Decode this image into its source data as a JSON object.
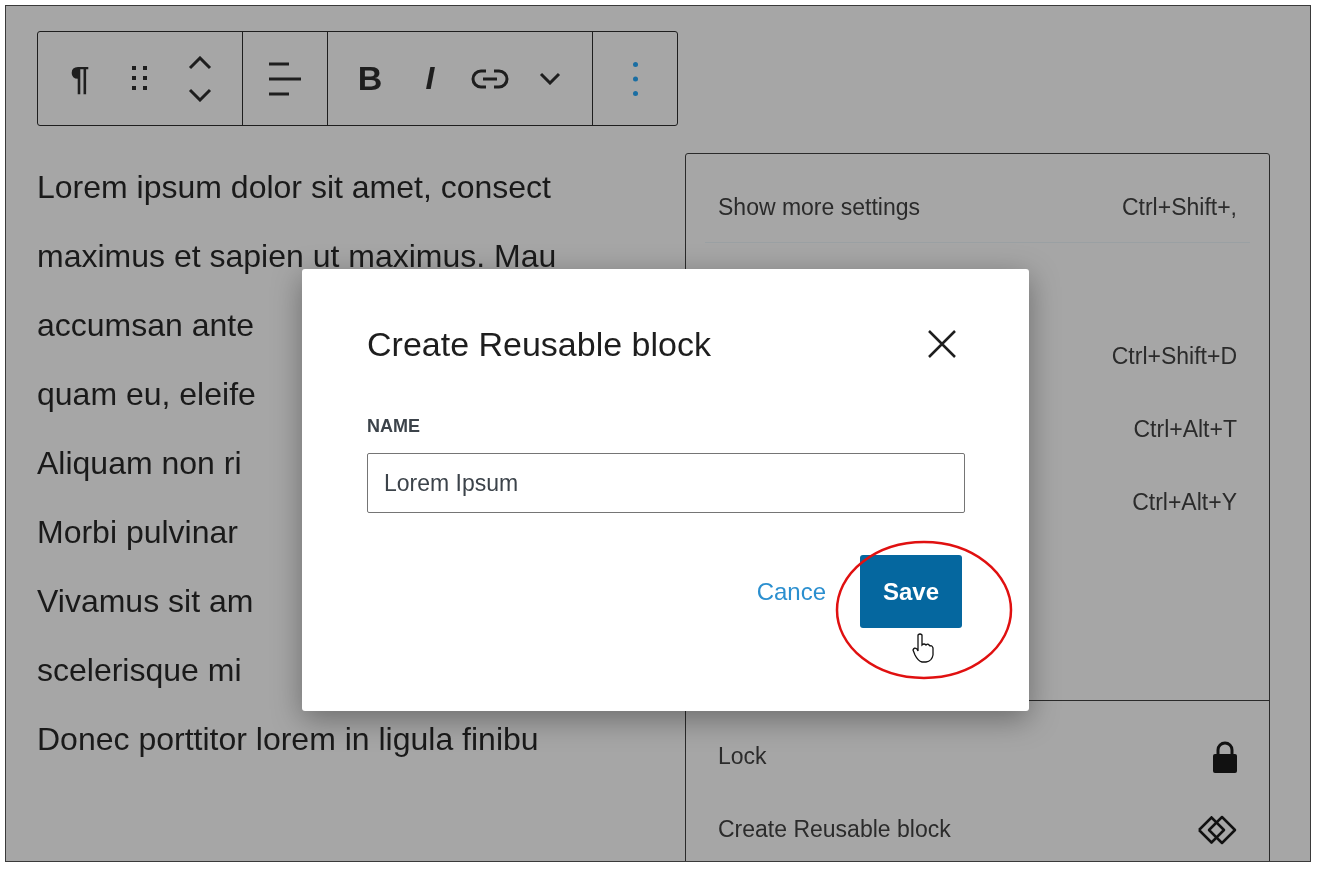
{
  "toolbar": {
    "paragraph_glyph": "¶",
    "bold": "B",
    "italic": "I"
  },
  "paragraph": {
    "lines": [
      "Lorem ipsum dolor sit amet, consect",
      "maximus et sapien ut maximus. Mau",
      "accumsan ante",
      "quam eu, eleife",
      "Aliquam non ri",
      "Morbi pulvinar",
      "Vivamus sit am",
      "scelerisque mi",
      "Donec porttitor lorem in ligula finibu"
    ]
  },
  "block_menu": {
    "sections": [
      {
        "items": [
          {
            "label": "Show more settings",
            "shortcut": "Ctrl+Shift+,"
          }
        ]
      },
      {
        "items": [
          {
            "shortcut": "Ctrl+Shift+D"
          },
          {
            "shortcut": "Ctrl+Alt+T"
          },
          {
            "shortcut": "Ctrl+Alt+Y"
          }
        ]
      },
      {
        "items": [
          {
            "label": "Lock"
          },
          {
            "label": "Create Reusable block"
          }
        ]
      }
    ]
  },
  "dialog": {
    "title": "Create Reusable block",
    "field": {
      "label": "NAME",
      "value": "Lorem Ipsum"
    },
    "buttons": [
      {
        "kind": "link",
        "label": "Cance"
      },
      {
        "kind": "primary",
        "label": "Save"
      }
    ]
  }
}
